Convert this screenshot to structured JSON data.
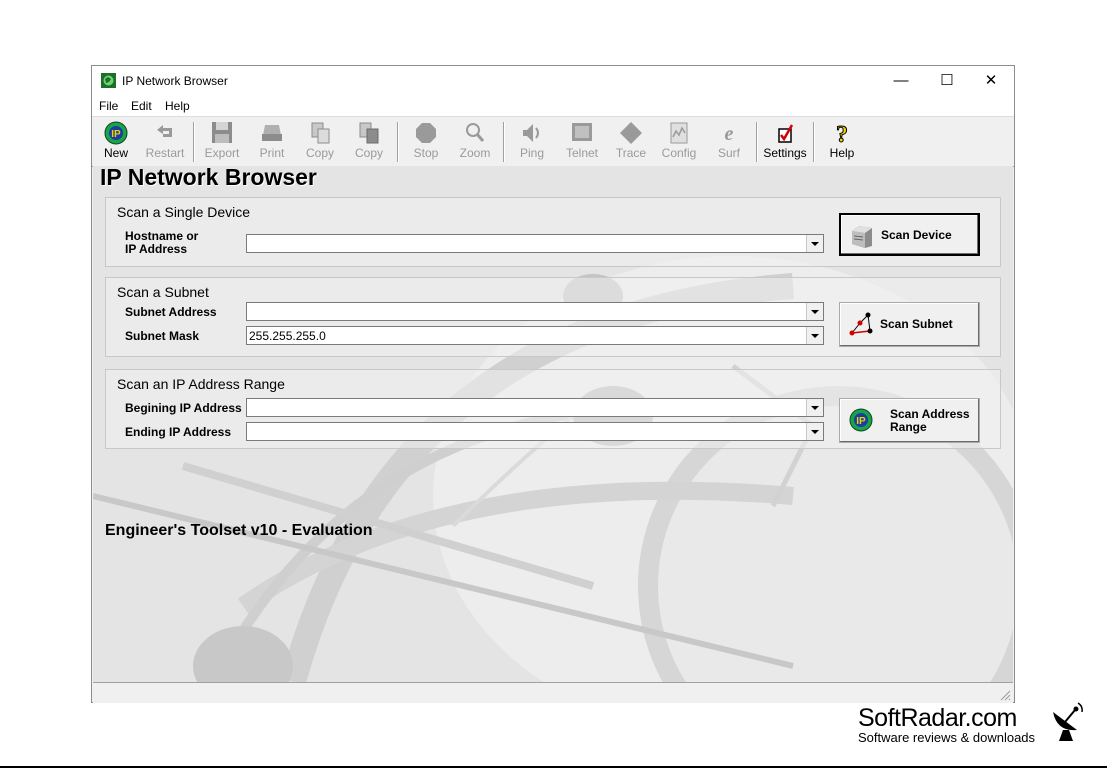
{
  "window": {
    "title": "IP Network Browser",
    "minimize": "—",
    "maximize": "☐",
    "close": "✕"
  },
  "menu": [
    "File",
    "Edit",
    "Help"
  ],
  "toolbar": {
    "new": "New",
    "restart": "Restart",
    "export": "Export",
    "print": "Print",
    "copy1": "Copy",
    "copy2": "Copy",
    "stop": "Stop",
    "zoom": "Zoom",
    "ping": "Ping",
    "telnet": "Telnet",
    "trace": "Trace",
    "config": "Config",
    "surf": "Surf",
    "settings": "Settings",
    "help": "Help"
  },
  "content": {
    "title": "IP Network Browser",
    "single": {
      "title": "Scan a Single Device",
      "host_label_1": "Hostname or",
      "host_label_2": "IP Address",
      "host_value": "",
      "button": "Scan Device"
    },
    "subnet": {
      "title": "Scan a Subnet",
      "address_label": "Subnet Address",
      "address_value": "",
      "mask_label": "Subnet Mask",
      "mask_value": "255.255.255.0",
      "button": "Scan Subnet"
    },
    "range": {
      "title": "Scan an IP Address Range",
      "begin_label": "Begining IP Address",
      "begin_value": "",
      "end_label": "Ending IP Address",
      "end_value": "",
      "button_1": "Scan Address",
      "button_2": "Range"
    },
    "footer": "Engineer's Toolset v10 - Evaluation"
  },
  "watermark": {
    "name": "SoftRadar.com",
    "tagline": "Software reviews & downloads"
  },
  "colors": {
    "ip_icon_green": "#1aa34a",
    "ip_icon_blue": "#1b3fa0",
    "settings_red": "#d40000",
    "help_yellow": "#f2d200"
  }
}
